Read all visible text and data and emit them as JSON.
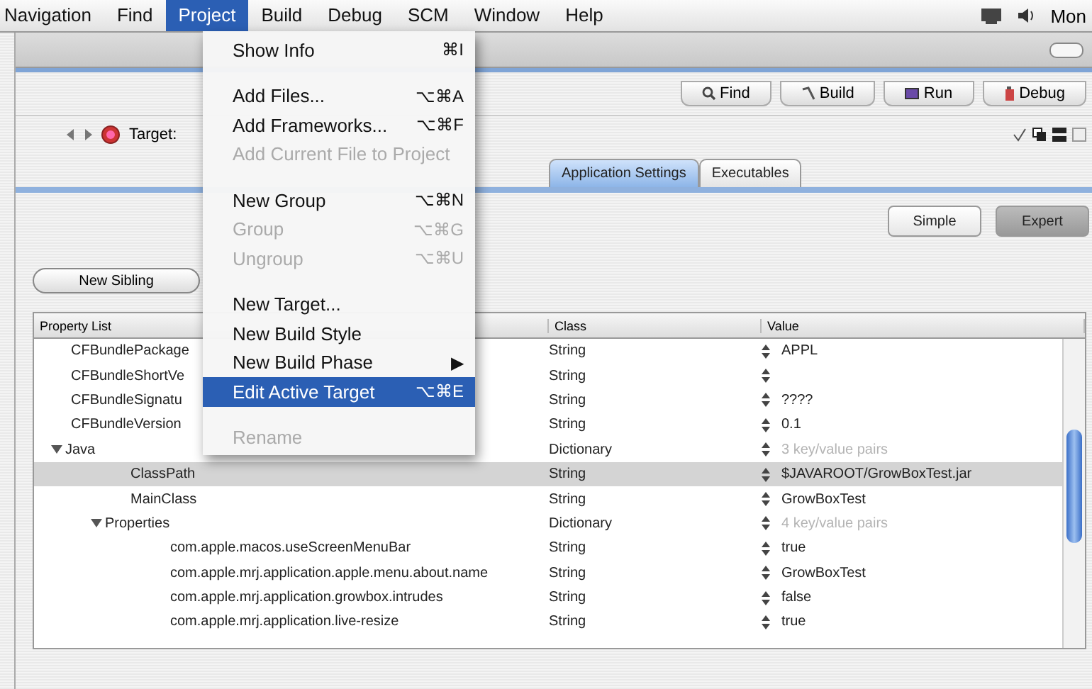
{
  "menubar": {
    "items": [
      {
        "label": "Navigation",
        "selected": false
      },
      {
        "label": "Find",
        "selected": false
      },
      {
        "label": "Project",
        "selected": true
      },
      {
        "label": "Build",
        "selected": false
      },
      {
        "label": "Debug",
        "selected": false
      },
      {
        "label": "SCM",
        "selected": false
      },
      {
        "label": "Window",
        "selected": false
      },
      {
        "label": "Help",
        "selected": false
      }
    ],
    "clock": "Mon"
  },
  "menu": {
    "items": [
      {
        "kind": "item",
        "label": "Show Info",
        "shortcut": "⌘I",
        "disabled": false,
        "selected": false
      },
      {
        "kind": "separator"
      },
      {
        "kind": "item",
        "label": "Add Files...",
        "shortcut": "⌥⌘A",
        "disabled": false,
        "selected": false
      },
      {
        "kind": "item",
        "label": "Add Frameworks...",
        "shortcut": "⌥⌘F",
        "disabled": false,
        "selected": false
      },
      {
        "kind": "item",
        "label": "Add Current File to Project",
        "disabled": true,
        "selected": false
      },
      {
        "kind": "separator"
      },
      {
        "kind": "item",
        "label": "New Group",
        "shortcut": "⌥⌘N",
        "disabled": false,
        "selected": false
      },
      {
        "kind": "item",
        "label": "Group",
        "shortcut": "⌥⌘G",
        "disabled": true,
        "selected": false
      },
      {
        "kind": "item",
        "label": "Ungroup",
        "shortcut": "⌥⌘U",
        "disabled": true,
        "selected": false
      },
      {
        "kind": "separator"
      },
      {
        "kind": "item",
        "label": "New Target...",
        "disabled": false,
        "selected": false
      },
      {
        "kind": "item",
        "label": "New Build Style",
        "disabled": false,
        "selected": false
      },
      {
        "kind": "item",
        "label": "New Build Phase",
        "submenu": "▶",
        "disabled": false,
        "selected": false
      },
      {
        "kind": "item",
        "label": "Edit Active Target",
        "shortcut": "⌥⌘E",
        "disabled": false,
        "selected": true
      },
      {
        "kind": "separator"
      },
      {
        "kind": "item",
        "label": "Rename",
        "disabled": true,
        "selected": false
      }
    ]
  },
  "toolbar": {
    "buttons": [
      "Find",
      "Build",
      "Run",
      "Debug"
    ]
  },
  "target": {
    "label": "Target:"
  },
  "tabs": [
    {
      "label": "Application Settings",
      "selected": true
    },
    {
      "label": "Executables",
      "selected": false
    }
  ],
  "modes": [
    {
      "label": "Simple",
      "selected": false
    },
    {
      "label": "Expert",
      "selected": true
    }
  ],
  "new_sibling": "New Sibling",
  "table": {
    "columns": [
      "Property List",
      "Class",
      "Value"
    ],
    "rows": [
      {
        "name": "CFBundlePackage",
        "class": "String",
        "value": "APPL",
        "selected": false
      },
      {
        "name": "CFBundleShortVe",
        "class": "String",
        "selected": false
      },
      {
        "name": "CFBundleSignatu",
        "class": "String",
        "value": "????",
        "selected": false
      },
      {
        "name": "CFBundleVersion",
        "class": "String",
        "value": "0.1",
        "selected": false
      },
      {
        "name": "Java",
        "class": "Dictionary",
        "value": "3 key/value pairs",
        "dimmed": true,
        "selected": false,
        "expanded": true,
        "children": [
          {
            "name": "ClassPath",
            "class": "String",
            "value": "$JAVAROOT/GrowBoxTest.jar",
            "selected": true
          },
          {
            "name": "MainClass",
            "class": "String",
            "value": "GrowBoxTest",
            "selected": false
          },
          {
            "name": "Properties",
            "class": "Dictionary",
            "value": "4 key/value pairs",
            "dimmed": true,
            "selected": false,
            "expanded": true,
            "children": [
              {
                "name": "com.apple.macos.useScreenMenuBar",
                "class": "String",
                "value": "true",
                "selected": false
              },
              {
                "name": "com.apple.mrj.application.apple.menu.about.name",
                "class": "String",
                "value": "GrowBoxTest",
                "selected": false
              },
              {
                "name": "com.apple.mrj.application.growbox.intrudes",
                "class": "String",
                "value": "false",
                "selected": false
              },
              {
                "name": "com.apple.mrj.application.live-resize",
                "class": "String",
                "value": "true",
                "selected": false
              }
            ]
          }
        ]
      }
    ]
  }
}
